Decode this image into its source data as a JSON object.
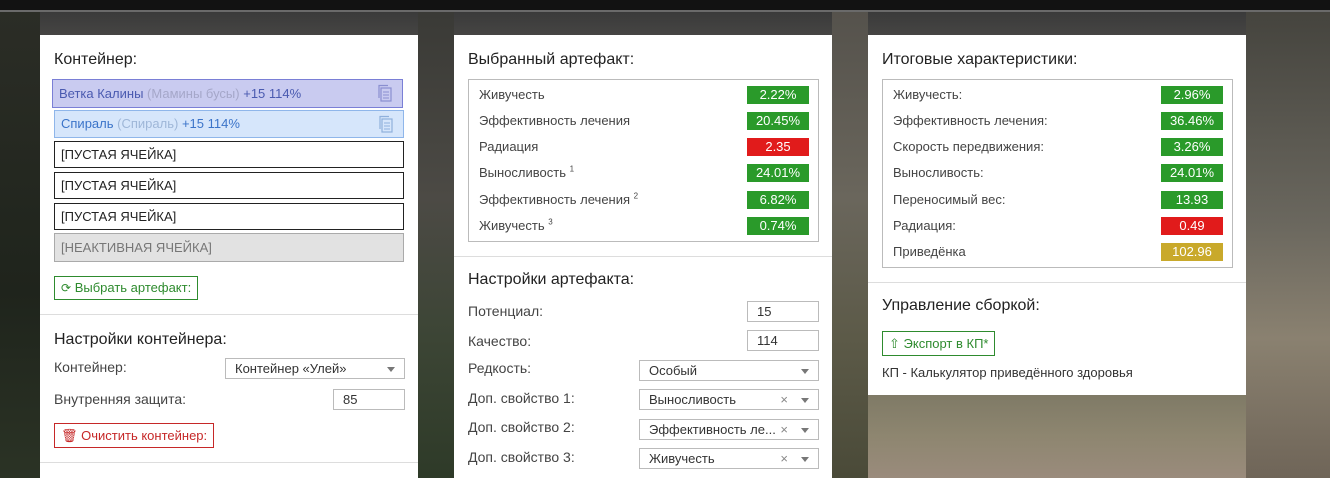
{
  "container_panel": {
    "title": "Контейнер:",
    "slots": [
      {
        "name": "Ветка Калины",
        "source": "(Мамины бусы)",
        "bonus": "+15 114%"
      },
      {
        "name": "Спираль",
        "source": "(Спираль)",
        "bonus": "+15 114%"
      },
      {
        "label": "[ПУСТАЯ ЯЧЕЙКА]"
      },
      {
        "label": "[ПУСТАЯ ЯЧЕЙКА]"
      },
      {
        "label": "[ПУСТАЯ ЯЧЕЙКА]"
      },
      {
        "label": "[НЕАКТИВНАЯ ЯЧЕЙКА]"
      }
    ],
    "choose_button": "Выбрать артефакт:",
    "settings_title": "Настройки контейнера:",
    "container_label": "Контейнер:",
    "container_value": "Контейнер «Улей»",
    "protection_label": "Внутренняя защита:",
    "protection_value": "85",
    "clear_button": "Очистить контейнер:"
  },
  "artifact_panel": {
    "title": "Выбранный артефакт:",
    "stats": [
      {
        "label": "Живучесть",
        "sup": "",
        "value": "2.22%",
        "color": "green"
      },
      {
        "label": "Эффективность лечения",
        "sup": "",
        "value": "20.45%",
        "color": "green"
      },
      {
        "label": "Радиация",
        "sup": "",
        "value": "2.35",
        "color": "red"
      },
      {
        "label": "Выносливость",
        "sup": "1",
        "value": "24.01%",
        "color": "green"
      },
      {
        "label": "Эффективность лечения",
        "sup": "2",
        "value": "6.82%",
        "color": "green"
      },
      {
        "label": "Живучесть",
        "sup": "3",
        "value": "0.74%",
        "color": "green"
      }
    ],
    "settings_title": "Настройки артефакта:",
    "potential_label": "Потенциал:",
    "potential_value": "15",
    "quality_label": "Качество:",
    "quality_value": "114",
    "rarity_label": "Редкость:",
    "rarity_value": "Особый",
    "prop1_label": "Доп. свойство 1:",
    "prop1_value": "Выносливость",
    "prop2_label": "Доп. свойство 2:",
    "prop2_value": "Эффективность ле...",
    "prop3_label": "Доп. свойство 3:",
    "prop3_value": "Живучесть",
    "clear_x": "×"
  },
  "totals_panel": {
    "title": "Итоговые характеристики:",
    "stats": [
      {
        "label": "Живучесть:",
        "value": "2.96%",
        "color": "green"
      },
      {
        "label": "Эффективность лечения:",
        "value": "36.46%",
        "color": "green"
      },
      {
        "label": "Скорость передвижения:",
        "value": "3.26%",
        "color": "green"
      },
      {
        "label": "Выносливость:",
        "value": "24.01%",
        "color": "green"
      },
      {
        "label": "Переносимый вес:",
        "value": "13.93",
        "color": "green"
      },
      {
        "label": "Радиация:",
        "value": "0.49",
        "color": "red"
      },
      {
        "label": "Приведёнка",
        "value": "102.96",
        "color": "yellow"
      }
    ],
    "build_title": "Управление сборкой:",
    "export_button": "Экспорт в КП*",
    "footnote": "КП - Калькулятор приведённого здоровья"
  },
  "colors": {
    "green": "#2a9a2a",
    "red": "#e11b1b",
    "yellow": "#c9a92b",
    "accent_green": "#2e8b2e",
    "accent_red": "#c62828"
  }
}
